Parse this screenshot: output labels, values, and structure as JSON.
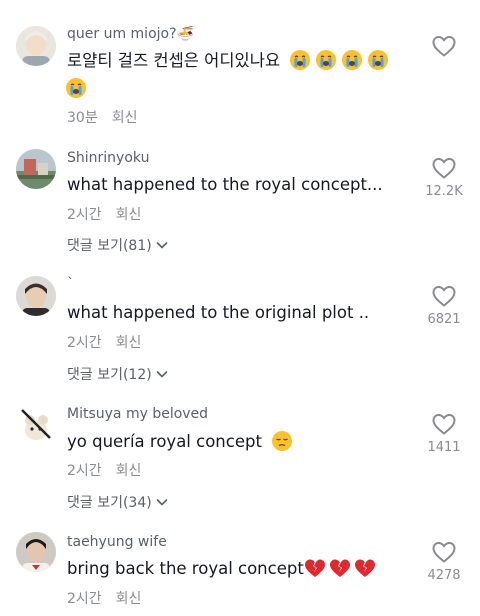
{
  "comments": [
    {
      "username": "quer um miojo?🍜",
      "text": "로얄티 걸즈 컨셉은 어디있나요",
      "time": "30분",
      "reply": "회신",
      "likes": ""
    },
    {
      "username": "Shinrinyoku",
      "text": "what happened to the royal concept...",
      "time": "2시간",
      "reply": "회신",
      "view_replies": "댓글 보기(81)",
      "likes": "12.2K"
    },
    {
      "username": "`",
      "text": "what happened to the original plot ..",
      "time": "2시간",
      "reply": "회신",
      "view_replies": "댓글 보기(12)",
      "likes": "6821"
    },
    {
      "username": "Mitsuya my beloved",
      "text": "yo quería royal concept",
      "time": "2시간",
      "reply": "회신",
      "view_replies": "댓글 보기(34)",
      "likes": "1411"
    },
    {
      "username": "taehyung wife",
      "text": "bring back the royal concept",
      "time": "2시간",
      "reply": "회신",
      "likes": "4278"
    }
  ],
  "icons": {
    "like": "heart-outline-icon",
    "expand": "chevron-down-icon",
    "crying": "loudly-crying-face-emoji",
    "pensive": "pensive-face-emoji",
    "broken_heart": "broken-heart-emoji"
  },
  "colors": {
    "primary_text": "#161823",
    "secondary_text": "#8a8b91",
    "username_text": "#5b5f69",
    "background": "#ffffff"
  }
}
